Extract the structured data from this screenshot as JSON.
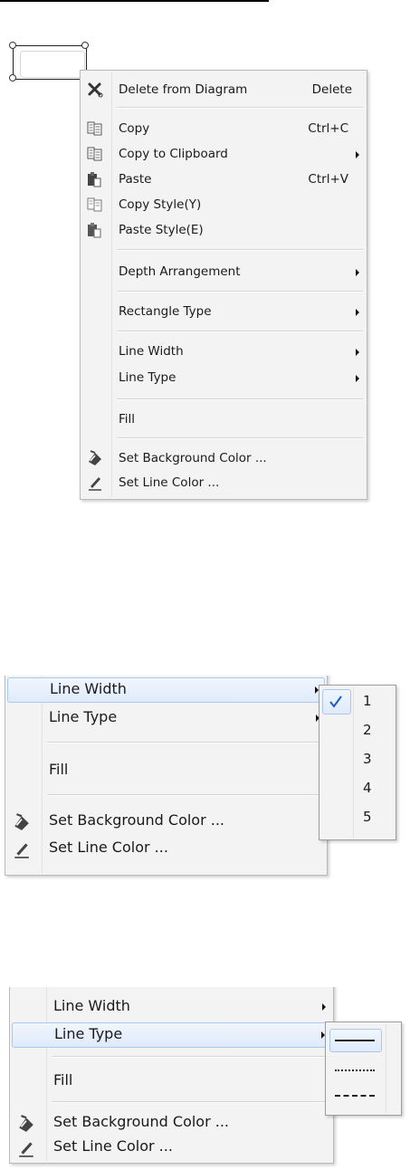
{
  "menu": {
    "items": [
      {
        "label": "Delete from Diagram",
        "shortcut": "Delete",
        "icon": "delete-x-icon"
      },
      {
        "label": "Copy",
        "shortcut": "Ctrl+C",
        "icon": "copy-icon"
      },
      {
        "label": "Copy to Clipboard",
        "icon": "copy-clipboard-icon",
        "submenu": true
      },
      {
        "label": "Paste",
        "shortcut": "Ctrl+V",
        "icon": "paste-icon"
      },
      {
        "label": "Copy Style(Y)",
        "icon": "copy-style-icon"
      },
      {
        "label": "Paste Style(E)",
        "icon": "paste-style-icon"
      },
      {
        "label": "Depth Arrangement",
        "submenu": true
      },
      {
        "label": "Rectangle Type",
        "submenu": true
      },
      {
        "label": "Line Width",
        "submenu": true
      },
      {
        "label": "Line Type",
        "submenu": true
      },
      {
        "label": "Fill"
      },
      {
        "label": "Set Background Color ...",
        "icon": "paint-bucket-icon"
      },
      {
        "label": "Set Line Color ...",
        "icon": "pencil-icon"
      }
    ]
  },
  "line_width_submenu": {
    "options": [
      "1",
      "2",
      "3",
      "4",
      "5"
    ],
    "selected": "1"
  },
  "line_type_submenu": {
    "options": [
      "solid",
      "dotted",
      "dashed"
    ],
    "selected": "solid"
  },
  "colors": {
    "menu_bg": "#f3f3f3",
    "highlight_border": "#a8c8ee",
    "check": "#1d5bbf"
  }
}
